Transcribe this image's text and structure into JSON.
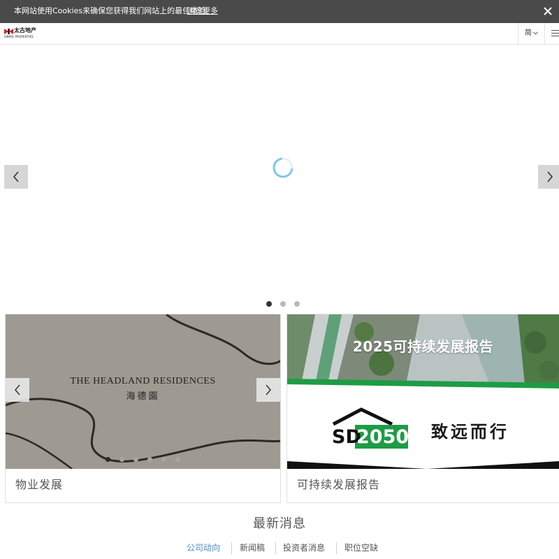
{
  "cookie_bar": {
    "message": "本网站使用Cookies来确保您获得我们网站上的最佳体验。",
    "link_label": "浏览更多"
  },
  "header": {
    "logo_cn": "太古地产",
    "logo_en": "SWIRE PROPERTIES",
    "language_label": "简"
  },
  "hero": {
    "slide_count": 3,
    "active_slide": 1
  },
  "cards": [
    {
      "caption": "物业发展",
      "image_title": "THE HEADLAND RESIDENCES",
      "image_subtitle": "海德園",
      "slide_count": 6,
      "active_slide": 1
    },
    {
      "caption": "可持续发展报告",
      "image_heading": "2025可持续发展报告",
      "badge_text": "SD2050",
      "slogan": "致远而行"
    }
  ],
  "news": {
    "title": "最新消息",
    "tabs": [
      {
        "label": "公司动向",
        "active": true
      },
      {
        "label": "新闻稿",
        "active": false
      },
      {
        "label": "投资者消息",
        "active": false
      },
      {
        "label": "职位空缺",
        "active": false
      }
    ]
  },
  "colors": {
    "cookie_bg": "#4a4a4a",
    "tab_active": "#4a8cc7",
    "brand_red": "#d2232a",
    "sd_green": "#1e9c45"
  }
}
